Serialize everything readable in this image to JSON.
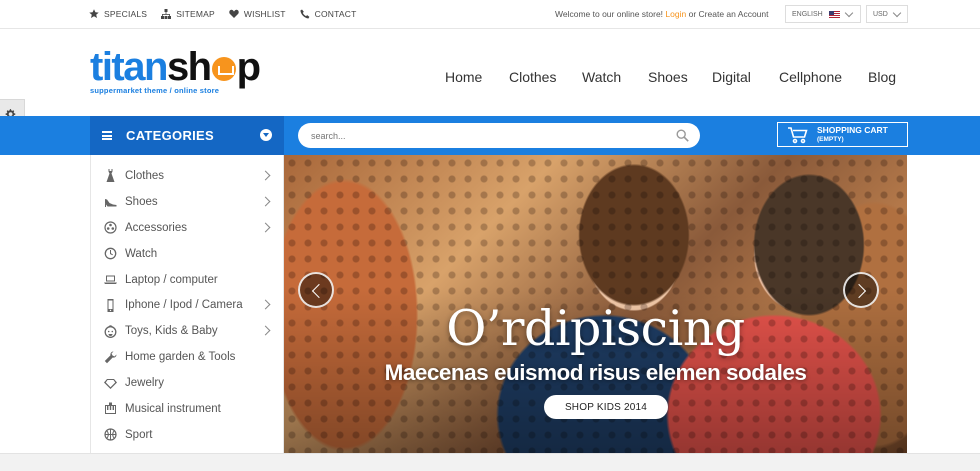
{
  "topbar": {
    "links": [
      {
        "label": "SPECIALS",
        "icon": "star-icon"
      },
      {
        "label": "SITEMAP",
        "icon": "sitemap-icon"
      },
      {
        "label": "WISHLIST",
        "icon": "heart-icon"
      },
      {
        "label": "CONTACT",
        "icon": "phone-icon"
      }
    ],
    "welcome_text": "Welcome to our online store!",
    "login_label": "Login",
    "or_text": "or",
    "create_account_label": "Create an Account",
    "language": "ENGLISH",
    "currency": "USD"
  },
  "logo": {
    "part1": "titan",
    "part2": "sh",
    "part3": "p",
    "tagline": "suppermarket theme / online store"
  },
  "nav": [
    "Home",
    "Clothes",
    "Watch",
    "Shoes",
    "Digital",
    "Cellphone",
    "Blog"
  ],
  "categories_title": "CATEGORIES",
  "search": {
    "placeholder": "search..."
  },
  "cart": {
    "title": "SHOPPING CART",
    "status": "(EMPTY)"
  },
  "sidebar": {
    "items": [
      {
        "label": "Clothes",
        "icon": "dress-icon",
        "has_sub": true
      },
      {
        "label": "Shoes",
        "icon": "shoe-icon",
        "has_sub": true
      },
      {
        "label": "Accessories",
        "icon": "accessories-icon",
        "has_sub": true
      },
      {
        "label": "Watch",
        "icon": "watch-icon",
        "has_sub": false
      },
      {
        "label": "Laptop / computer",
        "icon": "laptop-icon",
        "has_sub": false
      },
      {
        "label": "Iphone / Ipod / Camera",
        "icon": "phone-icon",
        "has_sub": true
      },
      {
        "label": "Toys, Kids & Baby",
        "icon": "baby-icon",
        "has_sub": true
      },
      {
        "label": "Home garden & Tools",
        "icon": "wrench-icon",
        "has_sub": false
      },
      {
        "label": "Jewelry",
        "icon": "diamond-icon",
        "has_sub": false
      },
      {
        "label": "Musical instrument",
        "icon": "music-icon",
        "has_sub": false
      },
      {
        "label": "Sport",
        "icon": "ball-icon",
        "has_sub": false
      }
    ]
  },
  "slide": {
    "title": "O’rdipiscing",
    "subtitle": "Maecenas euismod risus elemen sodales",
    "button": "SHOP KIDS 2014"
  },
  "colors": {
    "brand_blue": "#1b7fe0",
    "dark_blue": "#1467c4",
    "accent_orange": "#f7941d"
  }
}
